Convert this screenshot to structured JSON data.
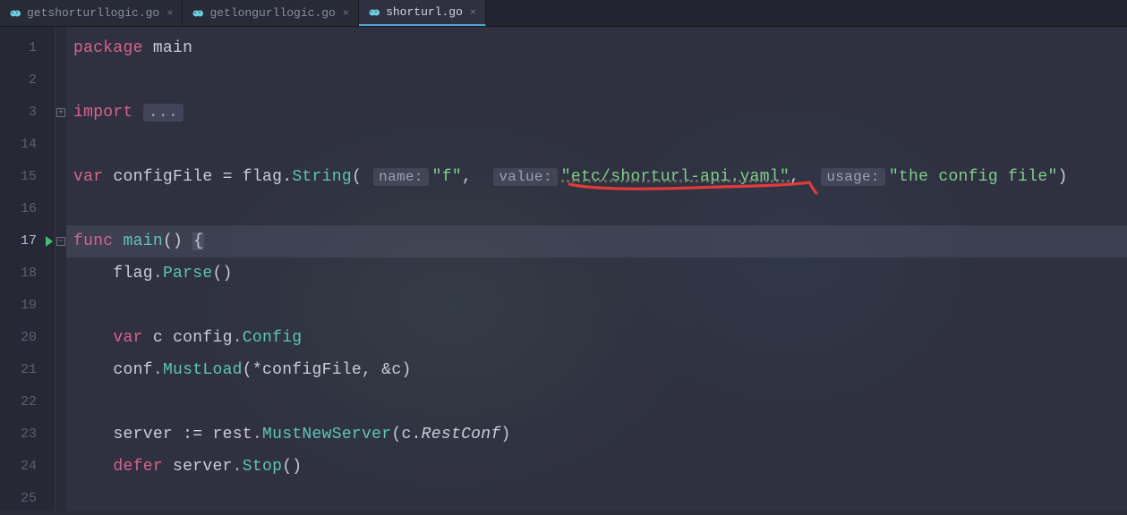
{
  "tabs": [
    {
      "label": "getshorturllogic.go",
      "active": false
    },
    {
      "label": "getlongurllogic.go",
      "active": false
    },
    {
      "label": "shorturl.go",
      "active": true
    }
  ],
  "gutter": {
    "lines": [
      "1",
      "2",
      "3",
      "14",
      "15",
      "16",
      "17",
      "18",
      "19",
      "20",
      "21",
      "22",
      "23",
      "24",
      "25"
    ],
    "current_index": 6,
    "run_marker_index": 6,
    "fold_plus_index": 2,
    "fold_minus_index": 6
  },
  "code": {
    "l1": {
      "kw": "package",
      "ident": "main"
    },
    "l3": {
      "kw": "import",
      "dots": "..."
    },
    "l15": {
      "kw": "var",
      "ident1": "configFile",
      "eq": "=",
      "obj": "flag",
      "dot": ".",
      "fn": "String",
      "lp": "(",
      "h1": "name:",
      "s1": "\"f\"",
      "c1": ",",
      "h2": "value:",
      "s2": "\"etc/shorturl-api.yaml\"",
      "c2": ",",
      "h3": "usage:",
      "s3": "\"the config file\"",
      "rp": ")"
    },
    "l17": {
      "kw": "func",
      "fn": "main",
      "par": "()",
      "brace": "{"
    },
    "l18": {
      "obj": "flag",
      "fn": "Parse",
      "par": "()"
    },
    "l20": {
      "kw": "var",
      "ident": "c",
      "pkg": "config",
      "typ": "Config"
    },
    "l21": {
      "obj": "conf",
      "fn": "MustLoad",
      "lp": "(",
      "star": "*",
      "arg1": "configFile",
      "c": ",",
      "amp": "&",
      "arg2": "c",
      "rp": ")"
    },
    "l23": {
      "ident": "server",
      "op": ":=",
      "obj": "rest",
      "fn": "MustNewServer",
      "lp": "(",
      "arg1": "c",
      "dot": ".",
      "arg2": "RestConf",
      "rp": ")"
    },
    "l24": {
      "kw": "defer",
      "obj": "server",
      "fn": "Stop",
      "par": "()"
    }
  }
}
